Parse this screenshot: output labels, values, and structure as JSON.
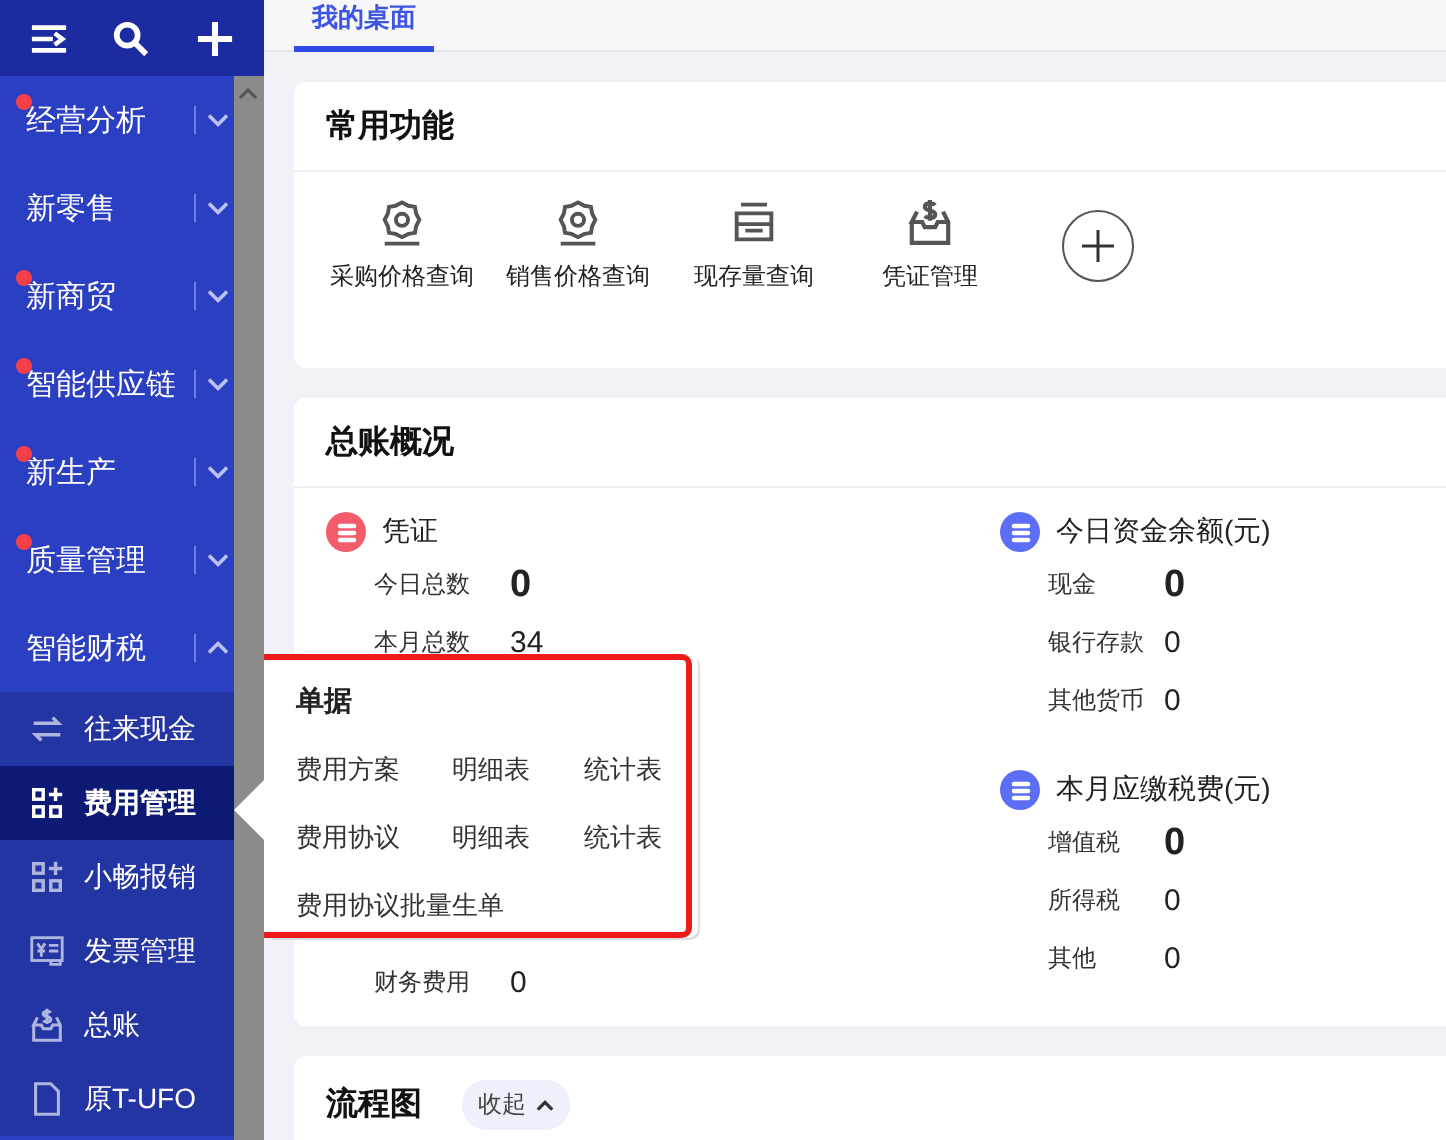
{
  "nav": {
    "items": [
      {
        "label": "经营分析",
        "badge": true,
        "expanded": false
      },
      {
        "label": "新零售",
        "badge": false,
        "expanded": false
      },
      {
        "label": "新商贸",
        "badge": true,
        "expanded": false
      },
      {
        "label": "智能供应链",
        "badge": true,
        "expanded": false
      },
      {
        "label": "新生产",
        "badge": true,
        "expanded": false
      },
      {
        "label": "质量管理",
        "badge": true,
        "expanded": false
      },
      {
        "label": "智能财税",
        "badge": false,
        "expanded": true,
        "children": [
          {
            "label": "往来现金",
            "kind": "exchange",
            "selected": false
          },
          {
            "label": "费用管理",
            "kind": "grid",
            "selected": true
          },
          {
            "label": "小畅报销",
            "kind": "grid",
            "selected": false
          },
          {
            "label": "发票管理",
            "kind": "invoice",
            "selected": false
          },
          {
            "label": "总账",
            "kind": "ledger",
            "selected": false
          },
          {
            "label": "原T-UFO",
            "kind": "doc",
            "selected": false
          }
        ]
      }
    ]
  },
  "tabs": [
    {
      "label": "我的桌面",
      "selected": true
    }
  ],
  "favorites": {
    "title": "常用功能",
    "items": [
      {
        "label": "采购价格查询",
        "kind": "gear"
      },
      {
        "label": "销售价格查询",
        "kind": "gear"
      },
      {
        "label": "现存量查询",
        "kind": "stock"
      },
      {
        "label": "凭证管理",
        "kind": "ledger"
      }
    ]
  },
  "ledger": {
    "title": "总账概况",
    "groups": [
      {
        "title": "凭证",
        "color": "#f25c6b",
        "rows": [
          {
            "label": "今日总数",
            "value": "0",
            "emphasis": true
          },
          {
            "label": "本月总数",
            "value": "34",
            "emphasis": false
          },
          {
            "label": "财务费用",
            "value": "0",
            "emphasis": false
          }
        ]
      },
      {
        "title": "今日资金余额(元)",
        "color": "#5b6ef5",
        "rows": [
          {
            "label": "现金",
            "value": "0",
            "emphasis": true
          },
          {
            "label": "银行存款",
            "value": "0",
            "emphasis": false
          },
          {
            "label": "其他货币",
            "value": "0",
            "emphasis": false
          }
        ]
      },
      {
        "title": "本月应缴税费(元)",
        "color": "#5b6ef5",
        "rows": [
          {
            "label": "增值税",
            "value": "0",
            "emphasis": true
          },
          {
            "label": "所得税",
            "value": "0",
            "emphasis": false
          },
          {
            "label": "其他",
            "value": "0",
            "emphasis": false
          }
        ]
      }
    ]
  },
  "flow": {
    "title": "流程图",
    "toggle": "收起"
  },
  "popup": {
    "title": "单据",
    "rows": [
      {
        "items": [
          "费用方案",
          "明细表",
          "统计表"
        ]
      },
      {
        "items": [
          "费用协议",
          "明细表",
          "统计表"
        ]
      },
      {
        "items": [
          "费用协议批量生单"
        ]
      }
    ]
  }
}
